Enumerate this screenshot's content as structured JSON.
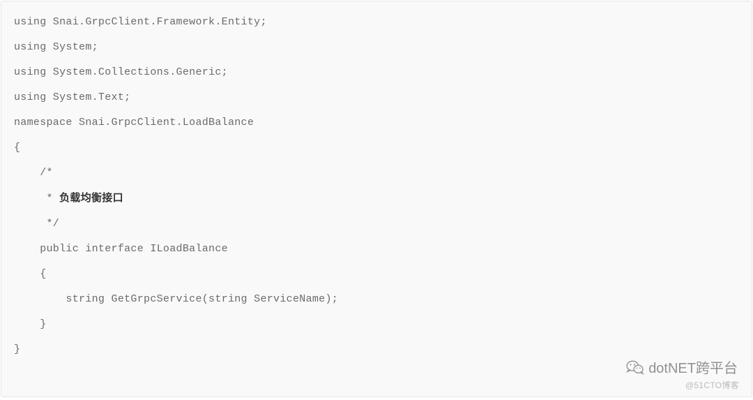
{
  "code": {
    "lines": [
      "using Snai.GrpcClient.Framework.Entity;",
      "using System;",
      "using System.Collections.Generic;",
      "using System.Text;",
      "",
      "namespace Snai.GrpcClient.LoadBalance",
      "{",
      "    /*",
      "     * 负载均衡接口",
      "     */",
      "    public interface ILoadBalance",
      "    {",
      "        string GetGrpcService(string ServiceName);",
      "    }",
      "}"
    ],
    "line_comment_prefix": "     * ",
    "line_comment_text": "负载均衡接口"
  },
  "watermark": {
    "text": "dotNET跨平台",
    "blog": "@51CTO博客"
  }
}
